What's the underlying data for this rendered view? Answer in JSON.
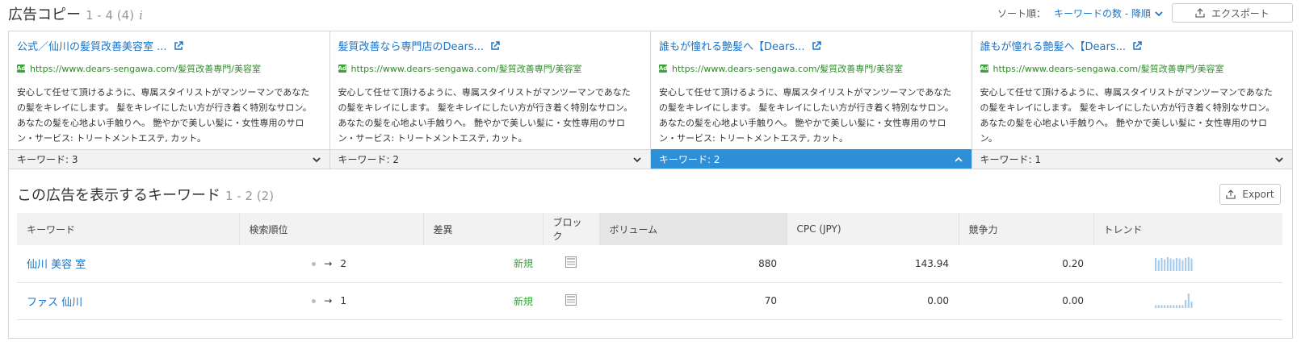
{
  "header": {
    "title": "広告コピー",
    "count": "1 - 4 (4)",
    "info_icon": "info-icon",
    "sort_label": "ソート順：",
    "sort_value": "キーワードの数 - 降順",
    "export_label": "エクスポート"
  },
  "ads": [
    {
      "title": "公式／仙川の髪質改善美容室 ...",
      "url": "https://www.dears-sengawa.com/髪質改善専門/美容室",
      "badge": "Ad",
      "description": "安心して任せて頂けるように、専属スタイリストがマンツーマンであなたの髪をキレイにします。 髪をキレイにしたい方が行き着く特別なサロン。あなたの髪を心地よい手触りへ。 艶やかで美しい髪に・女性専用のサロン・サービス: トリートメントエステ, カット。",
      "keywords": "キーワード: 3",
      "active": false
    },
    {
      "title": "髪質改善なら専門店のDears...",
      "url": "https://www.dears-sengawa.com/髪質改善専門/美容室",
      "badge": "Ad",
      "description": "安心して任せて頂けるように、専属スタイリストがマンツーマンであなたの髪をキレイにします。 髪をキレイにしたい方が行き着く特別なサロン。あなたの髪を心地よい手触りへ。 艶やかで美しい髪に・女性専用のサロン・サービス: トリートメントエステ, カット。",
      "keywords": "キーワード: 2",
      "active": false
    },
    {
      "title": "誰もが憧れる艶髪へ【Dears...",
      "url": "https://www.dears-sengawa.com/髪質改善専門/美容室",
      "badge": "Ad",
      "description": "安心して任せて頂けるように、専属スタイリストがマンツーマンであなたの髪をキレイにします。 髪をキレイにしたい方が行き着く特別なサロン。あなたの髪を心地よい手触りへ。 艶やかで美しい髪に・女性専用のサロン・サービス: トリートメントエステ, カット。",
      "keywords": "キーワード: 2",
      "active": true
    },
    {
      "title": "誰もが憧れる艶髪へ【Dears...",
      "url": "https://www.dears-sengawa.com/髪質改善専門/美容室",
      "badge": "Ad",
      "description": "安心して任せて頂けるように、専属スタイリストがマンツーマンであなたの髪をキレイにします。 髪をキレイにしたい方が行き着く特別なサロン。あなたの髪を心地よい手触りへ。 艶やかで美しい髪に・女性専用のサロン。",
      "keywords": "キーワード: 1",
      "active": false
    }
  ],
  "keywords_section": {
    "title": "この広告を表示するキーワード",
    "count": "1 - 2 (2)",
    "export_label": "Export",
    "columns": [
      "キーワード",
      "検索順位",
      "差異",
      "ブロック",
      "ボリューム",
      "CPC (JPY)",
      "競争力",
      "トレンド"
    ],
    "rows": [
      {
        "keyword": "仙川 美容 室",
        "arrow": "→",
        "rank": "2",
        "diff": "新規",
        "volume": "880",
        "cpc": "143.94",
        "competition": "0.20",
        "trend": [
          0.9,
          0.75,
          0.9,
          0.8,
          0.95,
          0.85,
          0.8,
          0.9,
          0.85,
          0.75,
          0.9,
          0.95,
          0.85
        ]
      },
      {
        "keyword": "ファス 仙川",
        "arrow": "→",
        "rank": "1",
        "diff": "新規",
        "volume": "70",
        "cpc": "0.00",
        "competition": "0.00",
        "trend": [
          0.2,
          0.2,
          0.2,
          0.2,
          0.2,
          0.2,
          0.2,
          0.2,
          0.2,
          0.2,
          0.55,
          1.0,
          0.45
        ]
      }
    ]
  },
  "colors": {
    "link": "#1a73c8",
    "url_green": "#2e8b28",
    "active_tab": "#2e8fd9",
    "trend_bar": "#a8cdec"
  }
}
